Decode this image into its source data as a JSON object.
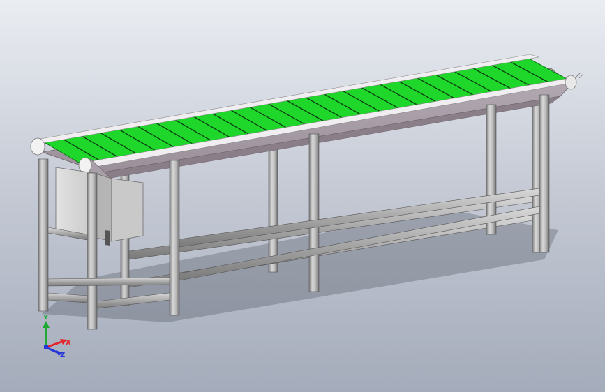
{
  "viewport": {
    "background_top": "#eaedf2",
    "background_bottom": "#a4abba"
  },
  "model": {
    "belt_color": "#1fd62a",
    "slat_color": "#0b3a0e",
    "frame_color": "#a89ea7",
    "frame_rail_color": "#f1eef1",
    "profile_color": "#b3b3b3",
    "motor_box_color": "#d7d7d7"
  },
  "triad": {
    "x_label": "X",
    "y_label": "Y",
    "z_label": "Z",
    "x_color": "#e3262b",
    "y_color": "#20a834",
    "z_color": "#2535d6",
    "x_icon": "arrow-x-icon",
    "y_icon": "arrow-y-icon",
    "z_icon": "arrow-z-icon"
  }
}
